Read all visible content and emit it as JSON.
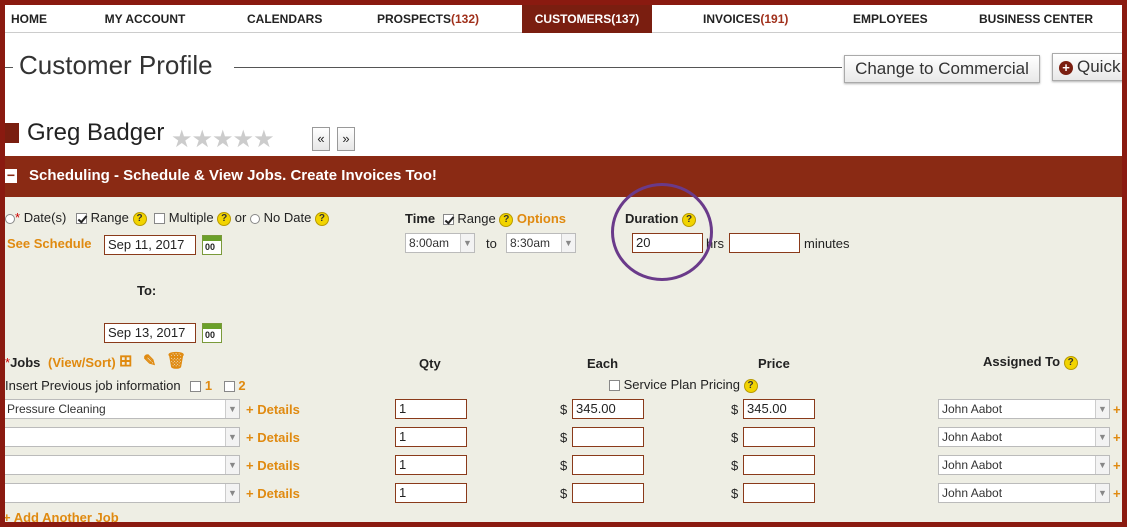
{
  "nav": {
    "items": [
      {
        "label": "HOME",
        "count": ""
      },
      {
        "label": "MY ACCOUNT",
        "count": ""
      },
      {
        "label": "CALENDARS",
        "count": ""
      },
      {
        "label": "PROSPECTS",
        "count": "(132)"
      },
      {
        "label": "CUSTOMERS",
        "count": "(137)"
      },
      {
        "label": "INVOICES",
        "count": "(191)"
      },
      {
        "label": "EMPLOYEES",
        "count": ""
      },
      {
        "label": "BUSINESS CENTER",
        "count": ""
      }
    ]
  },
  "header": {
    "title": "Customer Profile",
    "change_button": "Change to Commercial",
    "quick_button": "Quick"
  },
  "customer": {
    "name": "Greg Badger",
    "stars": "★★★★★",
    "prev": "«",
    "next": "»"
  },
  "section": {
    "collapse": "−",
    "title": "Scheduling - Schedule & View Jobs. Create Invoices Too!"
  },
  "date": {
    "label": "Date(s)",
    "range": "Range",
    "multiple": "Multiple",
    "or": "or",
    "no_date": "No Date",
    "see_schedule": "See Schedule",
    "from_value": "Sep 11, 2017",
    "to_label": "To:",
    "to_value": "Sep 13, 2017",
    "cal_text": "00"
  },
  "time": {
    "label": "Time",
    "range": "Range",
    "options": "Options",
    "start": "8:00am",
    "to": "to",
    "end": "8:30am"
  },
  "duration": {
    "label": "Duration",
    "hours_value": "20",
    "hrs": "hrs",
    "minutes_value": "",
    "minutes": "minutes"
  },
  "jobs": {
    "label": "Jobs",
    "view_sort": "(View/Sort)",
    "insert_prev": "Insert Previous job information",
    "opt1": "1",
    "opt2": "2",
    "qty_header": "Qty",
    "each_header": "Each",
    "price_header": "Price",
    "assigned_header": "Assigned To",
    "service_plan": "Service Plan Pricing",
    "details": "+ Details",
    "currency": "$",
    "add_another": "+ Add Another Job",
    "rows": [
      {
        "job": "Pressure Cleaning",
        "qty": "1",
        "each": "345.00",
        "price": "345.00",
        "assigned": "John Aabot"
      },
      {
        "job": "",
        "qty": "1",
        "each": "",
        "price": "",
        "assigned": "John Aabot"
      },
      {
        "job": "",
        "qty": "1",
        "each": "",
        "price": "",
        "assigned": "John Aabot"
      },
      {
        "job": "",
        "qty": "1",
        "each": "",
        "price": "",
        "assigned": "John Aabot"
      }
    ]
  },
  "help_glyph": "?"
}
